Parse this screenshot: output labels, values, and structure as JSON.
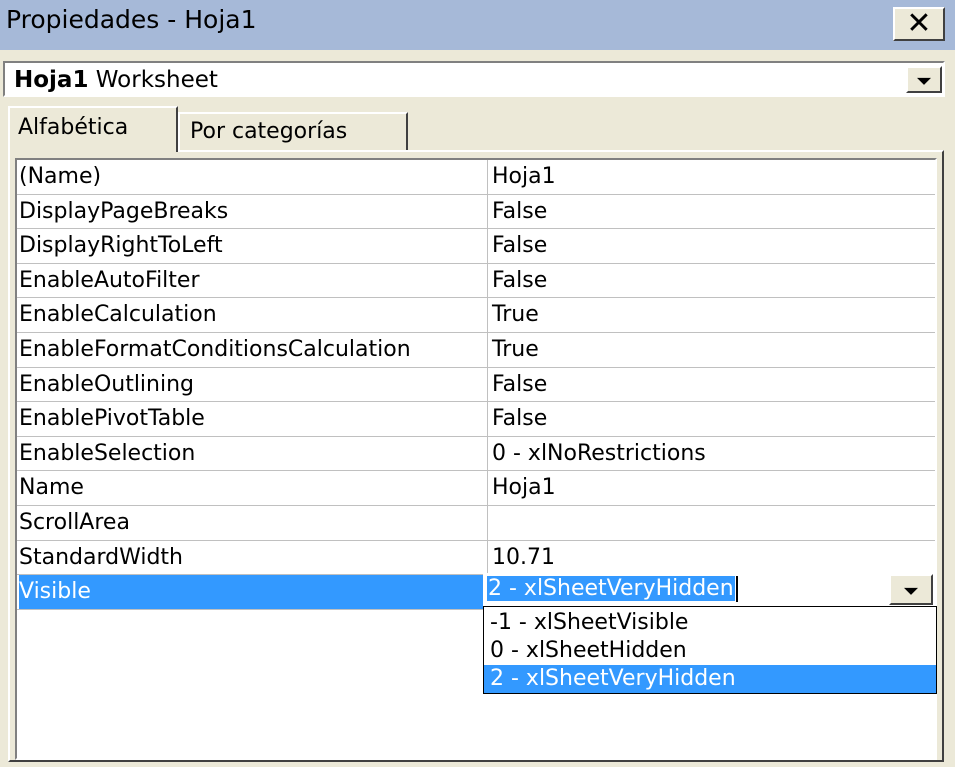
{
  "window": {
    "title": "Propiedades - Hoja1",
    "close_icon": "close-icon"
  },
  "object_selector": {
    "name": "Hoja1",
    "type": "Worksheet"
  },
  "tabs": [
    {
      "label": "Alfabética",
      "active": true
    },
    {
      "label": "Por categorías",
      "active": false
    }
  ],
  "properties": [
    {
      "name": "(Name)",
      "value": "Hoja1"
    },
    {
      "name": "DisplayPageBreaks",
      "value": "False"
    },
    {
      "name": "DisplayRightToLeft",
      "value": "False"
    },
    {
      "name": "EnableAutoFilter",
      "value": "False"
    },
    {
      "name": "EnableCalculation",
      "value": "True"
    },
    {
      "name": "EnableFormatConditionsCalculation",
      "value": "True"
    },
    {
      "name": "EnableOutlining",
      "value": "False"
    },
    {
      "name": "EnablePivotTable",
      "value": "False"
    },
    {
      "name": "EnableSelection",
      "value": "0 - xlNoRestrictions"
    },
    {
      "name": "Name",
      "value": "Hoja1"
    },
    {
      "name": "ScrollArea",
      "value": ""
    },
    {
      "name": "StandardWidth",
      "value": "10.71"
    },
    {
      "name": "Visible",
      "value": "2 - xlSheetVeryHidden",
      "selected": true
    }
  ],
  "visible_dropdown": {
    "current_value": "2 - xlSheetVeryHidden",
    "options": [
      {
        "label": "-1 - xlSheetVisible",
        "selected": false
      },
      {
        "label": "0 - xlSheetHidden",
        "selected": false
      },
      {
        "label": "2 - xlSheetVeryHidden",
        "selected": true
      }
    ]
  },
  "colors": {
    "titlebar": "#a6b9d8",
    "selection": "#3399ff",
    "face": "#ece9d8"
  }
}
